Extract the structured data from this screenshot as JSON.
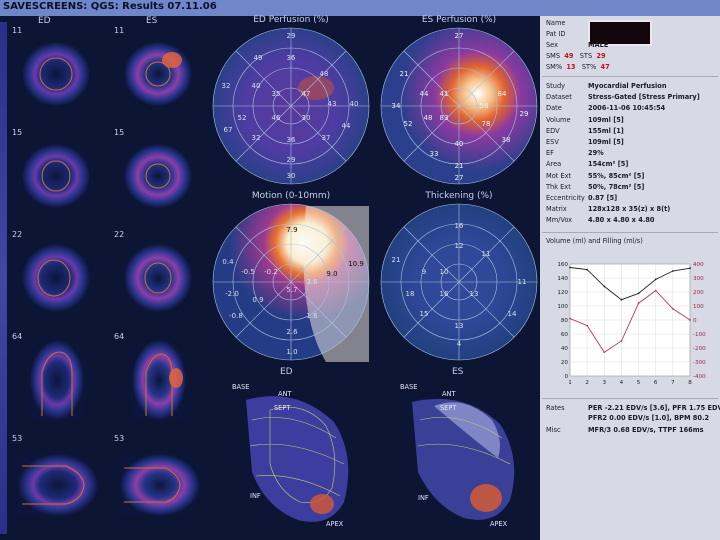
{
  "window": {
    "title": "SAVESCREENS: QGS: Results 07.11.06"
  },
  "slices": [
    {
      "row": 0,
      "left": "11",
      "right": "11",
      "labels": [
        "ED",
        "ES"
      ]
    },
    {
      "row": 1,
      "left": "15",
      "right": "15"
    },
    {
      "row": 2,
      "left": "22",
      "right": "22"
    },
    {
      "row": 3,
      "left": "64",
      "right": "64"
    },
    {
      "row": 4,
      "left": "53",
      "right": "53"
    }
  ],
  "polar_maps": {
    "ed_perfusion": {
      "title": "ED Perfusion (%)",
      "values": [
        "29",
        "36",
        "49",
        "48",
        "32",
        "40",
        "35",
        "47",
        "43",
        "40",
        "52",
        "67",
        "46",
        "30",
        "32",
        "37",
        "36",
        "29",
        "44",
        "30"
      ]
    },
    "es_perfusion": {
      "title": "ES Perfusion (%)",
      "values": [
        "27",
        "21",
        "44",
        "41",
        "56",
        "84",
        "83",
        "78",
        "52",
        "48",
        "40",
        "38",
        "33",
        "29",
        "21",
        "27",
        "34"
      ]
    },
    "motion": {
      "title": "Motion (0-10mm)",
      "values": [
        "7.9",
        "10.9",
        "9.0",
        "0.4",
        "-0.5",
        "-0.2",
        "-2.0",
        "3.6",
        "1.6",
        "5.7",
        "0.9",
        "-0.8",
        "2.6",
        "1.0"
      ]
    },
    "thickening": {
      "title": "Thickening (%)",
      "values": [
        "16",
        "12",
        "11",
        "21",
        "9",
        "10",
        "18",
        "13",
        "16",
        "11",
        "15",
        "13",
        "4",
        "14"
      ]
    }
  },
  "ed_label": "ED",
  "es_label": "ES",
  "model_labels": {
    "left": {
      "base": "BASE",
      "ant": "ANT",
      "sept": "SEPT",
      "inf": "INF",
      "apex": "APEX"
    },
    "right": {
      "base": "BASE",
      "ant": "ANT",
      "sept": "SEPT",
      "inf": "INF",
      "apex": "APEX"
    }
  },
  "patient": {
    "name_label": "Name",
    "patid_label": "Pat ID",
    "sex_label": "Sex",
    "sex_value": "MALE",
    "sms_label": "SMS",
    "sms_value": "49",
    "sts_label": "STS",
    "sts_value": "29",
    "smpct_label": "SM%",
    "smpct_value": "13",
    "stpct_label": "ST%",
    "stpct_value": "47"
  },
  "study": [
    {
      "k": "Study",
      "v": "Myocardial Perfusion"
    },
    {
      "k": "Dataset",
      "v": "Stress-Gated [Stress Primary]"
    },
    {
      "k": "Date",
      "v": "2006-11-06 10:45:54"
    },
    {
      "k": "Volume",
      "v": "109ml [5]"
    },
    {
      "k": "EDV",
      "v": "155ml [1]"
    },
    {
      "k": "ESV",
      "v": "109ml [5]"
    },
    {
      "k": "EF",
      "v": "29%"
    },
    {
      "k": "Area",
      "v": "154cm² [5]"
    },
    {
      "k": "Mot Ext",
      "v": "55%, 85cm² [5]"
    },
    {
      "k": "Thk Ext",
      "v": "50%, 78cm² [5]"
    },
    {
      "k": "Eccentricity",
      "v": "0.87 [5]"
    },
    {
      "k": "Matrix",
      "v": "128x128 x 35(z) x 8(t)"
    },
    {
      "k": "Mm/Vox",
      "v": "4.80 x 4.80 x 4.80"
    }
  ],
  "chart_data": {
    "type": "line",
    "title": "Volume (ml) and Filling (ml/s)",
    "x": [
      1,
      2,
      3,
      4,
      5,
      6,
      7,
      8
    ],
    "ylim": [
      0,
      160
    ],
    "y2lim": [
      -400,
      400
    ],
    "yticks": [
      "160",
      "140",
      "120",
      "100",
      "80",
      "60",
      "40",
      "20",
      "0"
    ],
    "y2ticks": [
      "400",
      "300",
      "200",
      "100",
      "0",
      "-100",
      "-200",
      "-300",
      "-400"
    ],
    "xticks": [
      "1",
      "2",
      "3",
      "4",
      "5",
      "6",
      "7",
      "8"
    ],
    "series": [
      {
        "name": "Volume",
        "axis": "left",
        "values": [
          155,
          152,
          128,
          109,
          118,
          138,
          150,
          154
        ]
      },
      {
        "name": "Filling",
        "axis": "right",
        "values": [
          10,
          -40,
          -230,
          -150,
          120,
          210,
          80,
          0
        ]
      }
    ]
  },
  "rates": {
    "rates_label": "Rates",
    "rates_line1": "PER -2.21 EDV/s [3.6], PFR 1.75 EDV/s [7.1]",
    "rates_line2": "PFR2 0.00 EDV/s [1.0], BPM 80.2",
    "misc_label": "Misc",
    "misc_line": "MFR/3 0.68 EDV/s, TTPF 166ms"
  },
  "colors": {
    "titlebar": "#6f86c8",
    "panel": "#d7dae4",
    "volume_line": "#222222",
    "filling_line": "#b83a55"
  }
}
